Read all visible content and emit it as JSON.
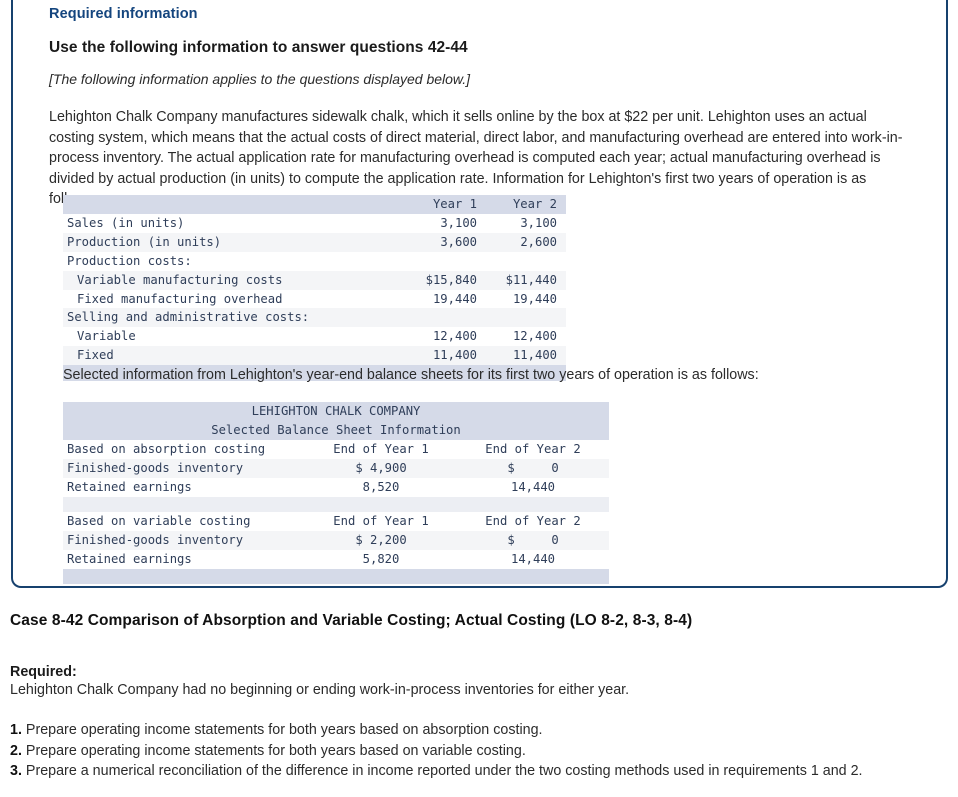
{
  "card": {
    "required_information_heading": "Required information",
    "use_heading": "Use the following information to answer questions 42-44",
    "applies_note": "[The following information applies to the questions displayed below.]",
    "intro_paragraph": "Lehighton Chalk Company manufactures sidewalk chalk, which it sells online by the box at $22 per unit. Lehighton uses an actual costing system, which means that the actual costs of direct material, direct labor, and manufacturing overhead are entered into work-in-process inventory. The actual application rate for manufacturing overhead is computed each year; actual manufacturing overhead is divided by actual production (in units) to compute the application rate. Information for Lehighton's first two years of operation is as follows:",
    "mid_paragraph": "Selected information from Lehighton's year-end balance sheets for its first two years of operation is as follows:"
  },
  "annual_table": {
    "columns": [
      "",
      "Year 1",
      "Year 2"
    ],
    "rows": [
      {
        "label": "Sales (in units)",
        "indent": 0,
        "y1": "3,100",
        "y2": "3,100"
      },
      {
        "label": "Production (in units)",
        "indent": 0,
        "y1": "3,600",
        "y2": "2,600"
      },
      {
        "label": "Production costs:",
        "indent": 0,
        "y1": "",
        "y2": ""
      },
      {
        "label": "Variable manufacturing costs",
        "indent": 1,
        "y1": "$15,840",
        "y2": "$11,440"
      },
      {
        "label": "Fixed manufacturing overhead",
        "indent": 1,
        "y1": "19,440",
        "y2": "19,440"
      },
      {
        "label": "Selling and administrative costs:",
        "indent": 0,
        "y1": "",
        "y2": ""
      },
      {
        "label": "Variable",
        "indent": 1,
        "y1": "12,400",
        "y2": "12,400"
      },
      {
        "label": "Fixed",
        "indent": 1,
        "y1": "11,400",
        "y2": "11,400"
      }
    ]
  },
  "balance_table": {
    "title_line1": "LEHIGHTON CHALK COMPANY",
    "title_line2": "Selected Balance Sheet Information",
    "sections": [
      {
        "header": {
          "label": "Based on absorption costing",
          "y1": "End of Year 1",
          "y2": "End of Year 2"
        },
        "rows": [
          {
            "label": "Finished-goods inventory",
            "y1": "$ 4,900",
            "y2": "$     0"
          },
          {
            "label": "Retained earnings",
            "y1": "8,520",
            "y2": "14,440"
          }
        ]
      },
      {
        "header": {
          "label": "Based on variable costing",
          "y1": "End of Year 1",
          "y2": "End of Year 2"
        },
        "rows": [
          {
            "label": "Finished-goods inventory",
            "y1": "$ 2,200",
            "y2": "$     0"
          },
          {
            "label": "Retained earnings",
            "y1": "5,820",
            "y2": "14,440"
          }
        ]
      }
    ]
  },
  "case_section": {
    "title": "Case 8-42 Comparison of Absorption and Variable Costing; Actual Costing (LO 8-2, 8-3, 8-4)",
    "required_label": "Required:",
    "required_text": "Lehighton Chalk Company had no beginning or ending work-in-process inventories for either year.",
    "requirements": [
      {
        "num": "1.",
        "text": " Prepare operating income statements for both years based on absorption costing."
      },
      {
        "num": "2.",
        "text": " Prepare operating income statements for both years based on variable costing."
      },
      {
        "num": "3.",
        "text": " Prepare a numerical reconciliation of the difference in income reported under the two costing methods used in requirements 1 and 2."
      }
    ]
  },
  "colors": {
    "card_border": "#17416e",
    "heading_blue": "#14457e",
    "table_band": "#d5dae8",
    "row_shade": "#f4f5f7",
    "mono_text": "#2f3e59"
  }
}
